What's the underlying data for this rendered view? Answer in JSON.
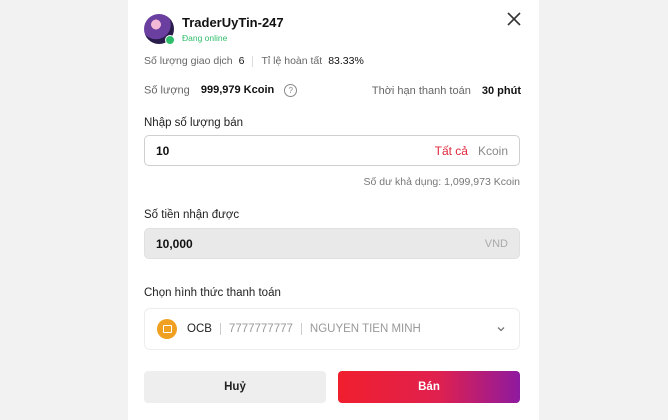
{
  "trader": {
    "username": "TraderUyTin-247",
    "status": "Đang online"
  },
  "stats": {
    "trades_label": "Số lượng giao dịch",
    "trades_value": "6",
    "completion_label": "Tỉ lệ hoàn tất",
    "completion_value": "83.33%"
  },
  "summary": {
    "quantity_label": "Số lượng",
    "quantity_value": "999,979 Kcoin",
    "time_limit_label": "Thời hạn thanh toán",
    "time_limit_value": "30 phút"
  },
  "sell_input": {
    "label": "Nhập số lượng bán",
    "value": "10",
    "all_label": "Tất cả",
    "unit": "Kcoin",
    "balance_text": "Số dư khả dụng: 1,099,973 Kcoin"
  },
  "receive": {
    "label": "Số tiền nhận được",
    "value": "10,000",
    "unit": "VND"
  },
  "payment": {
    "label": "Chọn hình thức thanh toán",
    "bank": "OCB",
    "account": "7777777777",
    "holder": "NGUYEN TIEN MINH"
  },
  "buttons": {
    "cancel": "Huỷ",
    "sell": "Bán"
  },
  "colors": {
    "online": "#2ebd6b",
    "accent_red": "#e0263a",
    "sell_gradient_start": "#f01f2e",
    "sell_gradient_end": "#8e1aa0",
    "bank_icon": "#f0a020"
  },
  "icons": {
    "close": "close-icon",
    "help": "help-icon",
    "bank": "bank-icon",
    "chevron": "chevron-down-icon"
  }
}
